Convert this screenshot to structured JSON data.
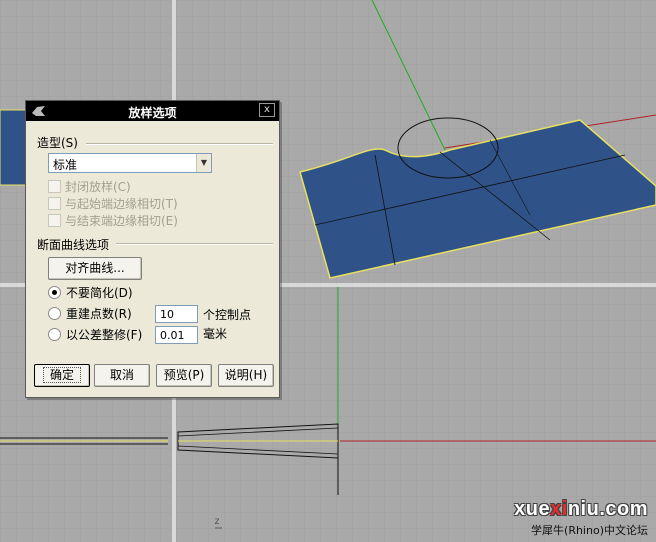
{
  "dialog": {
    "title": "放样选项",
    "close_label": "x",
    "style_group_label": "造型(S)",
    "style_value": "标准",
    "checkbox_closed_loft": "封闭放样(C)",
    "checkbox_tangent_start": "与起始端边缘相切(T)",
    "checkbox_tangent_end": "与结束端边缘相切(E)",
    "section_group_label": "断面曲线选项",
    "align_curves_label": "对齐曲线...",
    "radio_do_not_simplify": "不要简化(D)",
    "radio_rebuild": "重建点数(R)",
    "radio_refit": "以公差整修(F)",
    "rebuild_value": "10",
    "rebuild_suffix": "个控制点",
    "refit_value": "0.01",
    "refit_suffix": "毫米",
    "ok_label": "确定",
    "cancel_label": "取消",
    "preview_label": "预览(P)",
    "help_label": "说明(H)"
  },
  "watermark": {
    "prefix": "xue",
    "highlight": "xi",
    "suffix": "niu.com",
    "subtitle": "学犀牛(Rhino)中文论坛"
  },
  "viewport": {
    "axis_label": "z"
  },
  "colors": {
    "surface": "#2f5388",
    "edge_highlight": "#e8e060",
    "grid_line": "#9a9a9a",
    "axis_green": "#22aa22",
    "axis_red": "#b22222"
  }
}
